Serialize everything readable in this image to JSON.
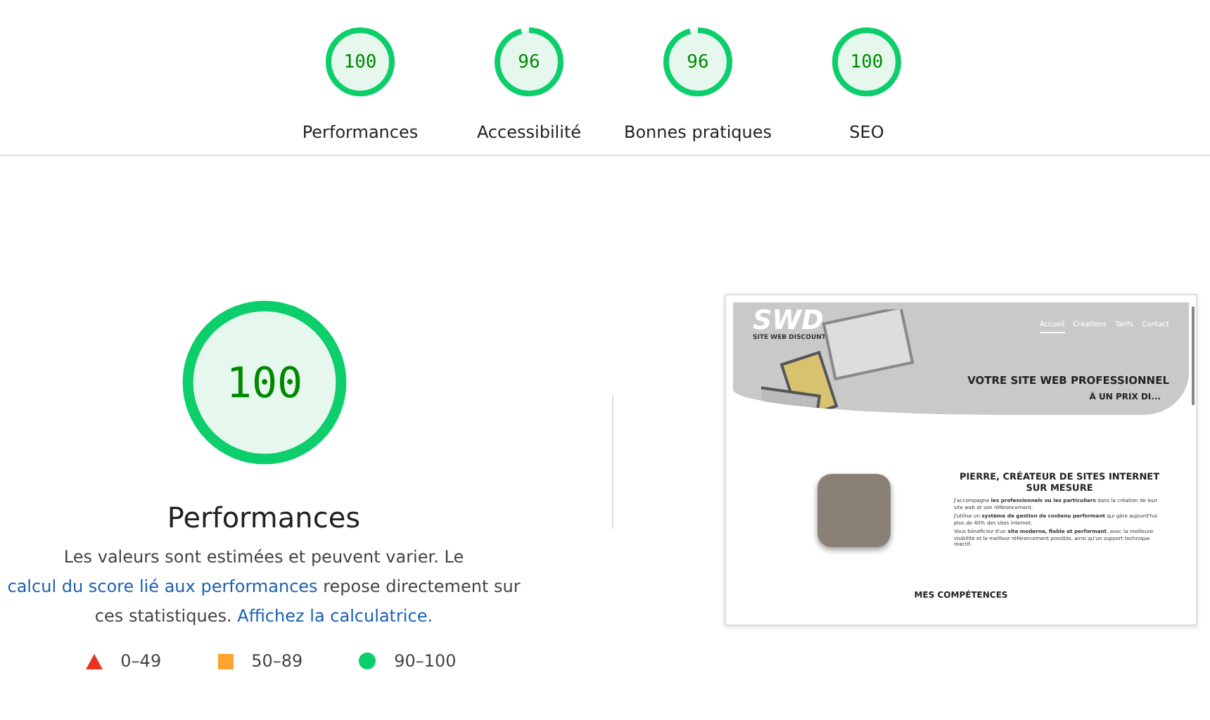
{
  "categories": [
    {
      "score": "100",
      "level": 1,
      "label": "Performances"
    },
    {
      "score": "96",
      "level": 0.96,
      "label": "Accessibilité"
    },
    {
      "score": "96",
      "level": 0.96,
      "label": "Bonnes pratiques"
    },
    {
      "score": "100",
      "level": 1,
      "label": "SEO"
    }
  ],
  "main": {
    "score": "100",
    "level": 1,
    "title": "Performances",
    "description": [
      {
        "kind": "text",
        "text": "Les valeurs sont estimées et peuvent varier. Le "
      },
      {
        "kind": "link",
        "text": "calcul du score lié aux performances"
      },
      {
        "kind": "text",
        "text": " repose directement sur ces statistiques. "
      },
      {
        "kind": "link",
        "text": "Affichez la calculatrice."
      }
    ],
    "legend": [
      {
        "kind": "triangle",
        "color": "#eb3323",
        "range": "0–49"
      },
      {
        "kind": "square",
        "color": "#ffa32f",
        "range": "50–89"
      },
      {
        "kind": "circle",
        "color": "#0cce6b",
        "range": "90–100"
      }
    ]
  },
  "screenshot": {
    "logo": "SWD",
    "tagline": "SITE WEB DISCOUNT",
    "nav": [
      {
        "label": "Accueil",
        "selected": true
      },
      {
        "label": "Créations",
        "selected": false
      },
      {
        "label": "Tarifs",
        "selected": false
      },
      {
        "label": "Contact",
        "selected": false
      }
    ],
    "headline": "VOTRE SITE WEB PROFESSIONNEL",
    "subheadline": "À UN PRIX DI...",
    "heading": "PIERRE, CRÉATEUR DE SITES INTERNET SUR MESURE",
    "paragraphs": [
      "J'accompagne **les professionnels ou les particuliers** dans la création de leur site web et son référencement.",
      "J'utilise un **système de gestion de contenu performant** qui gère aujourd'hui plus de 40% des sites internet.",
      "Vous bénéficiez d'un **site moderne, fiable et performant**, avec la meilleure visibilité et le meilleur référencement possible, ainsi qu'un support technique réactif."
    ],
    "section_title": "MES COMPÉTENCES"
  }
}
